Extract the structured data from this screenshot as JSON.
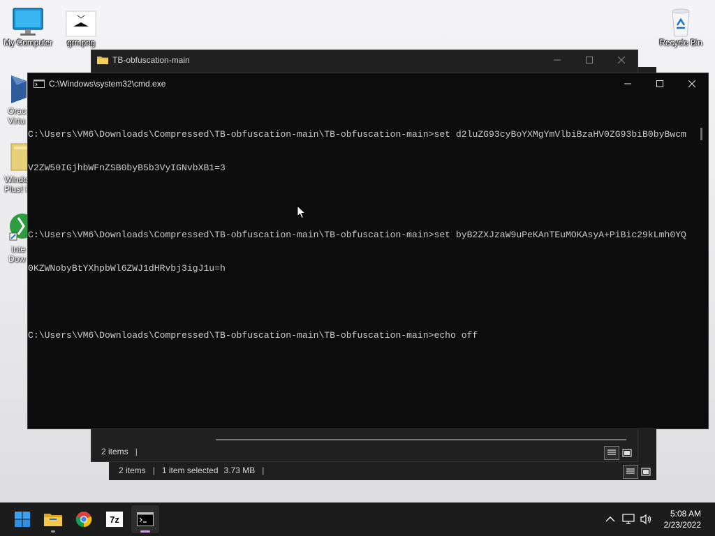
{
  "desktop": {
    "icons": [
      {
        "label": "My Computer"
      },
      {
        "label": "grrr.png"
      },
      {
        "label": "Recycle Bin"
      }
    ],
    "partial_icons": [
      {
        "line1": "Orac",
        "line2": "Virtu"
      },
      {
        "line1": "Windo",
        "line2": "Plus! F"
      },
      {
        "line1": "Inte",
        "line2": "Dow"
      }
    ]
  },
  "explorer_front": {
    "title": "TB-obfuscation-main",
    "status_count": "2 items"
  },
  "explorer_back": {
    "status_count": "2 items",
    "status_selected": "1 item selected",
    "status_size": "3.73 MB"
  },
  "cmd": {
    "title": "C:\\Windows\\system32\\cmd.exe",
    "lines": [
      "C:\\Users\\VM6\\Downloads\\Compressed\\TB-obfuscation-main\\TB-obfuscation-main>set d2luZG93cyBoYXMgYmVlbiBzaHV0ZG93biB0byBwcm",
      "V2ZW50IGjhbWFnZSB0byB5b3VyIGNvbXB1=3",
      "",
      "C:\\Users\\VM6\\Downloads\\Compressed\\TB-obfuscation-main\\TB-obfuscation-main>set byB2ZXJzaW9uPeKAnTEuMOKAsyA+PiBic29kLmh0YQ",
      "0KZWNobyBtYXhpbWl6ZWJ1dHRvbj3igJ1u=h",
      "",
      "C:\\Users\\VM6\\Downloads\\Compressed\\TB-obfuscation-main\\TB-obfuscation-main>echo off"
    ]
  },
  "taskbar": {
    "apps": [
      {
        "name": "start",
        "icon": "windows-logo-icon"
      },
      {
        "name": "file-explorer",
        "icon": "folder-icon"
      },
      {
        "name": "chrome",
        "icon": "chrome-icon"
      },
      {
        "name": "7-zip",
        "icon": "7zip-icon",
        "text": "7z"
      },
      {
        "name": "command-prompt",
        "icon": "terminal-icon",
        "active": true
      }
    ],
    "clock_time": "5:08 AM",
    "clock_date": "2/23/2022"
  },
  "colors": {
    "console_bg": "#0c0c0c",
    "console_text": "#cccccc",
    "taskbar_bg": "#1c1c1c",
    "explorer_bg": "#202020"
  }
}
